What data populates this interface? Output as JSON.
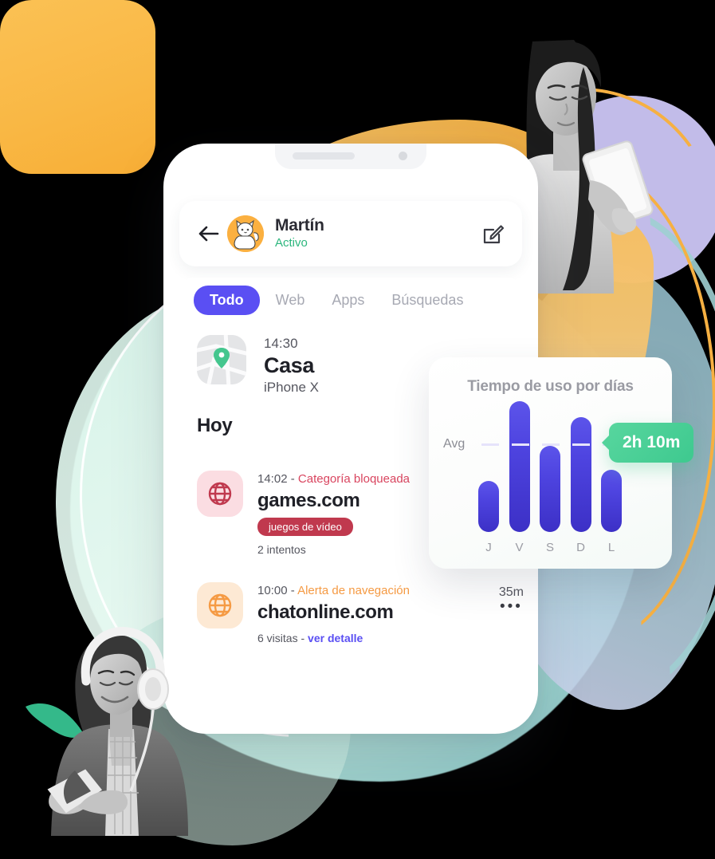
{
  "app": {
    "profile": {
      "name": "Martín",
      "status": "Activo",
      "back_icon": "back-arrow-icon",
      "edit_icon": "edit-pencil-icon",
      "avatar_icon": "cat-avatar"
    },
    "tabs": [
      {
        "label": "Todo",
        "active": true
      },
      {
        "label": "Web",
        "active": false
      },
      {
        "label": "Apps",
        "active": false
      },
      {
        "label": "Búsquedas",
        "active": false
      }
    ],
    "location": {
      "time": "14:30",
      "title": "Casa",
      "device": "iPhone X",
      "icon": "map-pin-icon"
    },
    "section_heading": "Hoy",
    "activities": [
      {
        "time": "14:02",
        "separator": "-",
        "category": "Categoría bloqueada",
        "domain": "games.com",
        "chip": "juegos de vídeo",
        "sub": "2 intentos",
        "icon": "globe-icon",
        "accent": "#d9455f"
      },
      {
        "time": "10:00",
        "separator": "-",
        "category": "Alerta de navegación",
        "domain": "chatonline.com",
        "sub_count": "6 visitas",
        "sub_sep": "-",
        "sub_link": "ver detalle",
        "duration": "35m",
        "more": "•••",
        "icon": "globe-icon",
        "accent": "#f59a43"
      }
    ]
  },
  "chart_card": {
    "tooltip": "2h 10m",
    "avg_label": "Avg"
  },
  "chart_data": {
    "type": "bar",
    "title": "Tiempo de uso por días",
    "categories": [
      "J",
      "V",
      "S",
      "D",
      "L"
    ],
    "values": [
      1.15,
      2.95,
      1.95,
      2.6,
      1.4
    ],
    "value_unit": "hours",
    "average": 2.17,
    "average_label": "Avg",
    "average_display": "2h 10m",
    "xlabel": "",
    "ylabel": "",
    "ylim": [
      0,
      3.1
    ],
    "grid": false,
    "legend": "none",
    "annotations": [
      {
        "text": "2h 10m",
        "type": "average-callout",
        "position": "right"
      }
    ]
  },
  "colors": {
    "accent_purple": "#5a4ff3",
    "bar_top": "#5c54ea",
    "bar_bottom": "#3c30c6",
    "green": "#2cb67d",
    "tooltip_green": "#3ec98f",
    "red": "#d9455f",
    "chip_red": "#c0394e",
    "orange": "#f59a43",
    "blob_orange": "#f8b94f",
    "blob_violet": "#ccc6f6",
    "blob_teal": "#bde8dd",
    "blob_steel": "#9fc4cf"
  }
}
